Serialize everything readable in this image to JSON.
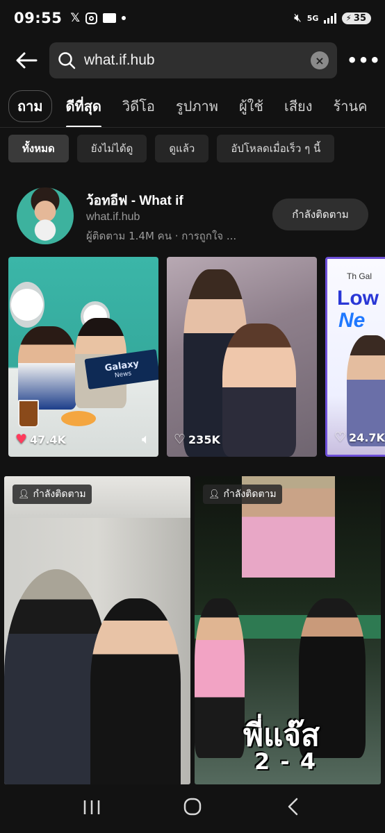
{
  "status_bar": {
    "time": "09:55",
    "left_icons": [
      "x-icon",
      "instagram-icon",
      "folder-icon",
      "dot-icon"
    ],
    "network": "5G",
    "battery": "35"
  },
  "search": {
    "query": "what.if.hub",
    "back_icon": "back-arrow-icon",
    "search_icon": "search-icon",
    "clear_icon": "clear-icon",
    "more_icon": "more-icon"
  },
  "tabs": [
    {
      "label": "ถาม"
    },
    {
      "label": "ดีที่สุด"
    },
    {
      "label": "วิดีโอ"
    },
    {
      "label": "รูปภาพ"
    },
    {
      "label": "ผู้ใช้"
    },
    {
      "label": "เสียง"
    },
    {
      "label": "ร้านค"
    }
  ],
  "filters": [
    {
      "label": "ทั้งหมด"
    },
    {
      "label": "ยังไม่ได้ดู"
    },
    {
      "label": "ดูแล้ว"
    },
    {
      "label": "อัปโหลดเมื่อเร็ว ๆ นี้"
    }
  ],
  "account": {
    "name": "ว้อทอีฟ - What if",
    "handle": "what.if.hub",
    "meta": "ผู้ติดตาม 1.4M คน · การถูกใจ ...",
    "follow_label": "กำลังติดตาม"
  },
  "videos": [
    {
      "likes": "47.4K",
      "sign": "Galaxy",
      "sign_sub": "News"
    },
    {
      "likes": "235K"
    },
    {
      "likes": "24.7K",
      "brand": "Th Gal",
      "big1": "Low",
      "big2": "Ne"
    }
  ],
  "grid": [
    {
      "tag": "กำลังติดตาม"
    },
    {
      "tag": "กำลังติดตาม",
      "title": "พี่แจ๊ส",
      "score": "2 - 4"
    }
  ],
  "colors": {
    "background": "#121212",
    "heart_liked": "#ff3b5c",
    "accent_purple": "#6d4fd8"
  }
}
